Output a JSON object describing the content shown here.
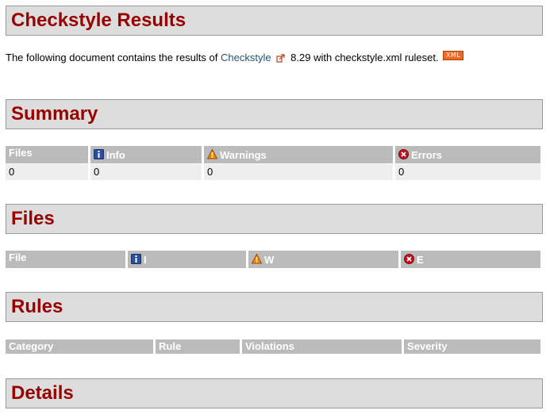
{
  "headings": {
    "title": "Checkstyle Results",
    "summary": "Summary",
    "files": "Files",
    "rules": "Rules",
    "details": "Details"
  },
  "intro": {
    "prefix": "The following document contains the results of ",
    "link_text": "Checkstyle",
    "suffix": " 8.29 with checkstyle.xml ruleset. ",
    "badge": "XML"
  },
  "summary_table": {
    "headers": [
      "Files",
      "Info",
      "Warnings",
      "Errors"
    ],
    "values": [
      "0",
      "0",
      "0",
      "0"
    ]
  },
  "files_table": {
    "headers": [
      "File",
      "I",
      "W",
      "E"
    ]
  },
  "rules_table": {
    "headers": [
      "Category",
      "Rule",
      "Violations",
      "Severity"
    ]
  },
  "icons": {
    "external_link": "external-link-icon",
    "info": "info-icon",
    "warning": "warning-icon",
    "error": "error-icon"
  },
  "colors": {
    "heading_text": "#990000",
    "heading_bg": "#dddddd",
    "table_header_bg": "#bbbbbb",
    "table_row_bg": "#eeeeee",
    "link": "#225577",
    "badge": "#f26822"
  }
}
